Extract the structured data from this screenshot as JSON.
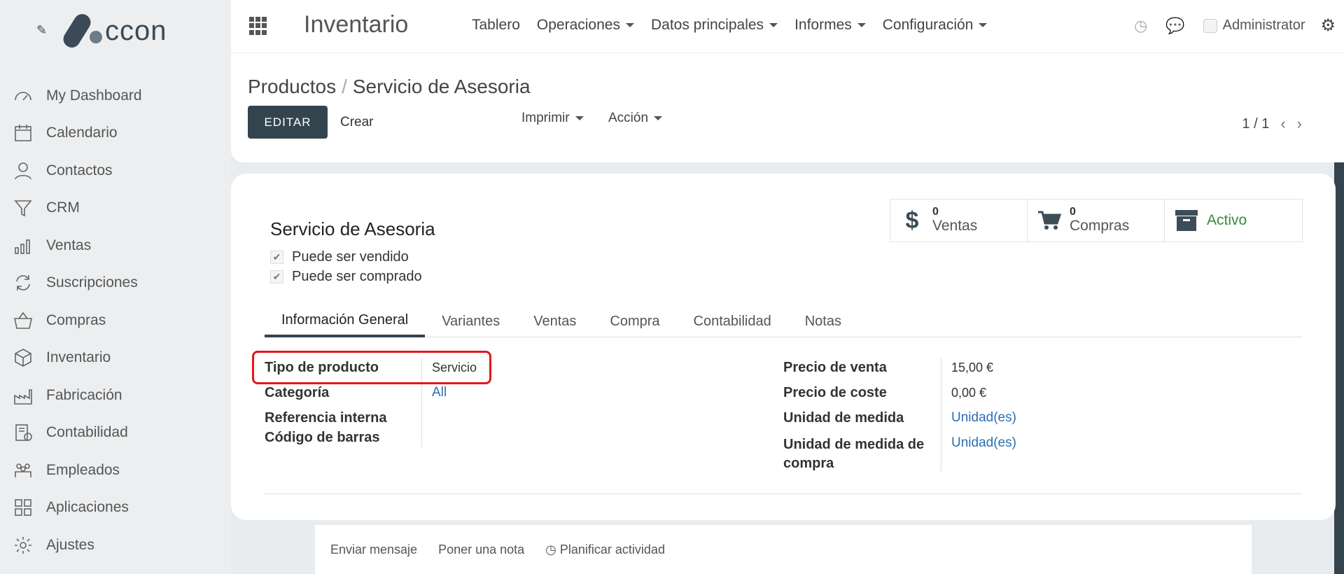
{
  "sidebar": {
    "logo_text": "ccon",
    "items": [
      {
        "label": "My Dashboard",
        "icon": "dashboard-gauge-icon"
      },
      {
        "label": "Calendario",
        "icon": "calendar-icon"
      },
      {
        "label": "Contactos",
        "icon": "person-icon"
      },
      {
        "label": "CRM",
        "icon": "funnel-icon"
      },
      {
        "label": "Ventas",
        "icon": "bar-chart-icon"
      },
      {
        "label": "Suscripciones",
        "icon": "refresh-icon"
      },
      {
        "label": "Compras",
        "icon": "basket-icon"
      },
      {
        "label": "Inventario",
        "icon": "box-icon"
      },
      {
        "label": "Fabricación",
        "icon": "factory-icon"
      },
      {
        "label": "Contabilidad",
        "icon": "invoice-icon"
      },
      {
        "label": "Empleados",
        "icon": "people-icon"
      },
      {
        "label": "Aplicaciones",
        "icon": "grid-icon"
      },
      {
        "label": "Ajustes",
        "icon": "gear-icon"
      }
    ]
  },
  "topbar": {
    "app_title": "Inventario",
    "nav": [
      "Tablero",
      "Operaciones",
      "Datos principales",
      "Informes",
      "Configuración"
    ],
    "user": "Administrator"
  },
  "control_panel": {
    "breadcrumb_parent": "Productos",
    "breadcrumb_sep": "/",
    "breadcrumb_current": "Servicio de Asesoria",
    "edit_label": "EDITAR",
    "create_label": "Crear",
    "print_label": "Imprimir",
    "action_label": "Acción",
    "pager": "1 / 1"
  },
  "stats": {
    "sales_count": "0",
    "sales_label": "Ventas",
    "purchases_count": "0",
    "purchases_label": "Compras",
    "active_label": "Activo"
  },
  "product": {
    "name": "Servicio de Asesoria",
    "can_be_sold": "Puede ser vendido",
    "can_be_purchased": "Puede ser comprado"
  },
  "tabs": [
    "Información General",
    "Variantes",
    "Ventas",
    "Compra",
    "Contabilidad",
    "Notas"
  ],
  "fields_left": {
    "type_label": "Tipo de producto",
    "type_value": "Servicio",
    "category_label": "Categoría",
    "category_value": "All",
    "ref_label": "Referencia interna",
    "barcode_label": "Código de barras"
  },
  "fields_right": {
    "sale_price_label": "Precio de venta",
    "sale_price_value": "15,00 €",
    "cost_label": "Precio de coste",
    "cost_value": "0,00 €",
    "uom_label": "Unidad de medida",
    "uom_value": "Unidad(es)",
    "purchase_uom_label_1": "Unidad de medida de",
    "purchase_uom_label_2": "compra",
    "purchase_uom_value": "Unidad(es)"
  },
  "chatter": {
    "send_message": "Enviar mensaje",
    "log_note": "Poner una nota",
    "schedule_activity": "Planificar actividad"
  },
  "colors": {
    "primary": "#34444f",
    "link": "#2a6fb5",
    "active_green": "#3b8a3e",
    "highlight_red": "#e4171b"
  }
}
